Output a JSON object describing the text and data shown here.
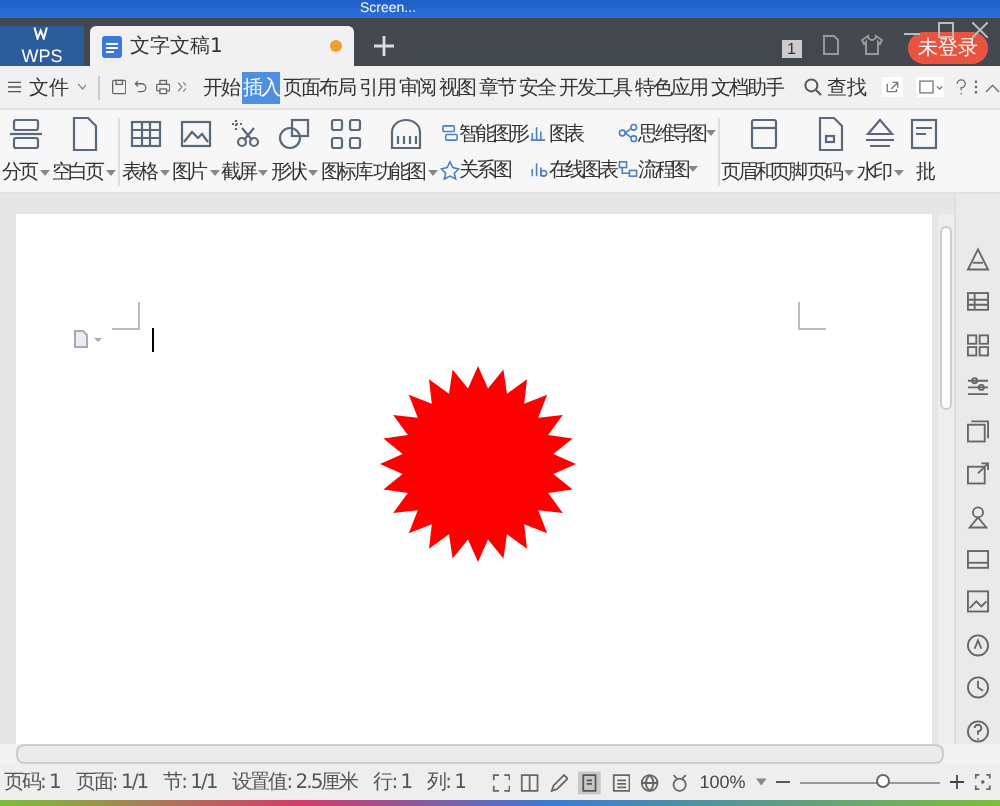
{
  "taskbar": {
    "items": [
      "Screen..."
    ]
  },
  "tabs": [
    {
      "label": "WPS",
      "kind": "app",
      "selected": false,
      "unsaved": false
    },
    {
      "label": "文字文稿1",
      "kind": "doc",
      "selected": true,
      "unsaved": true
    }
  ],
  "tabbar_right": {
    "badge": "1",
    "login": "未登录"
  },
  "menu": {
    "file": "文件",
    "search": "查找",
    "tabs": [
      {
        "label": "开始",
        "selected": false
      },
      {
        "label": "插入",
        "selected": true
      },
      {
        "label": "页面布局",
        "selected": false
      },
      {
        "label": "引用",
        "selected": false
      },
      {
        "label": "审阅",
        "selected": false
      },
      {
        "label": "视图",
        "selected": false
      },
      {
        "label": "章节",
        "selected": false
      },
      {
        "label": "安全",
        "selected": false
      },
      {
        "label": "开发工具",
        "selected": false
      },
      {
        "label": "特色应用",
        "selected": false
      },
      {
        "label": "文档助手",
        "selected": false
      }
    ]
  },
  "ribbon": {
    "groups": [
      {
        "kind": "large",
        "items": [
          {
            "label": "分页",
            "caret": true
          },
          {
            "label": "空白页",
            "caret": true
          }
        ]
      },
      {
        "kind": "large",
        "items": [
          {
            "label": "表格",
            "caret": true
          },
          {
            "label": "图片",
            "caret": true
          },
          {
            "label": "截屏",
            "caret": true
          },
          {
            "label": "形状",
            "caret": true
          },
          {
            "label": "图标库",
            "caret": false
          },
          {
            "label": "功能图",
            "caret": true
          }
        ]
      },
      {
        "kind": "small",
        "items": [
          {
            "label": "智能图形",
            "caret": false
          },
          {
            "label": "关系图",
            "caret": false
          },
          {
            "label": "图表",
            "caret": false
          },
          {
            "label": "在线图表",
            "caret": false
          },
          {
            "label": "思维导图",
            "caret": true
          },
          {
            "label": "流程图",
            "caret": true
          }
        ]
      },
      {
        "kind": "large",
        "items": [
          {
            "label": "页眉和页脚",
            "caret": false
          },
          {
            "label": "页码",
            "caret": true
          },
          {
            "label": "水印",
            "caret": true
          },
          {
            "label": "批",
            "caret": false
          }
        ]
      }
    ]
  },
  "status_bar": {
    "items": [
      "页码: 1",
      "页面: 1/1",
      "节: 1/1",
      "设置值: 2.5厘米",
      "行: 1",
      "列: 1"
    ],
    "zoom": "100%",
    "level": 0.6
  }
}
